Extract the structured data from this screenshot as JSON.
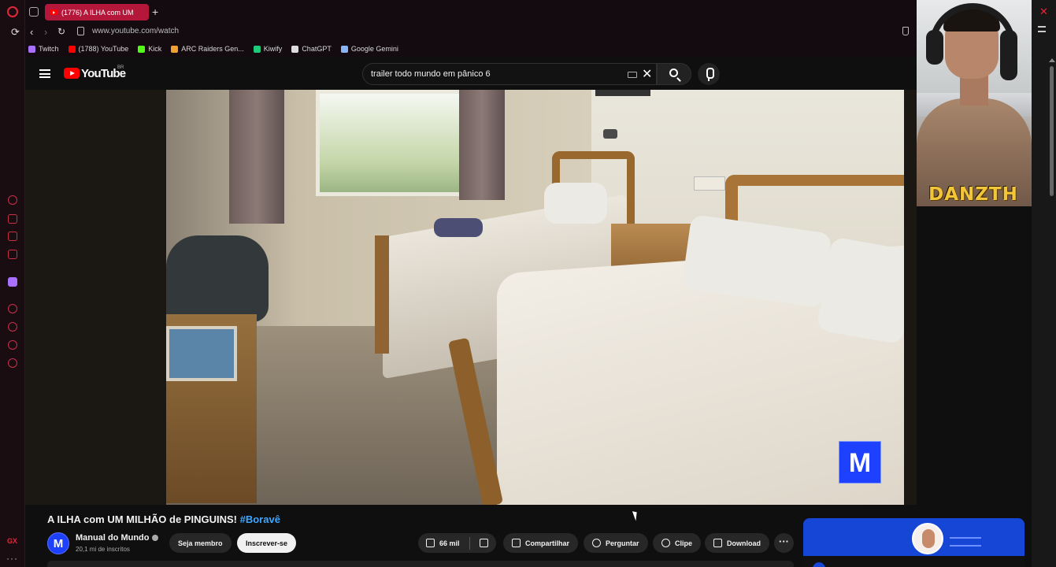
{
  "browser": {
    "tab_title": "(1776) A ILHA com UM",
    "new_tab_symbol": "+",
    "url": "www.youtube.com/watch",
    "bookmarks": [
      {
        "label": "Twitch",
        "color": "#a970ff"
      },
      {
        "label": "(1788) YouTube",
        "color": "#ff0000"
      },
      {
        "label": "Kick",
        "color": "#53fc18"
      },
      {
        "label": "ARC Raiders Gen...",
        "color": "#f0a030"
      },
      {
        "label": "Kiwify",
        "color": "#1ec97a"
      },
      {
        "label": "ChatGPT",
        "color": "#dddddd"
      },
      {
        "label": "Google Gemini",
        "color": "#8ab4f8"
      }
    ]
  },
  "youtube": {
    "logo_text": "YouTube",
    "country_code": "BR",
    "search_value": "trailer todo mundo em pânico 6",
    "clear_symbol": "✕"
  },
  "overlay": {
    "streamer_tag": "DANZTH",
    "video_badge": "M"
  },
  "video": {
    "title": "A ILHA com UM MILHÃO de PINGUINS!",
    "hashtag": "#Boravê",
    "channel_initial": "M",
    "channel_name": "Manual do Mundo",
    "subscribers": "20,1 mi de inscritos",
    "join_label": "Seja membro",
    "subscribe_label": "Inscrever-se",
    "likes": "66 mil",
    "share_label": "Compartilhar",
    "ask_label": "Perguntar",
    "clip_label": "Clipe",
    "download_label": "Download",
    "more_symbol": "···"
  },
  "sidebar": {
    "gx_label": "GX",
    "more_symbol": "···"
  },
  "window": {
    "close_symbol": "✕"
  },
  "colors": {
    "tab_active": "#b5173a",
    "youtube_red": "#ff0000",
    "hashtag_blue": "#3ea6ff",
    "channel_blue": "#1e40ff",
    "streamer_gold": "#f2c63a"
  }
}
